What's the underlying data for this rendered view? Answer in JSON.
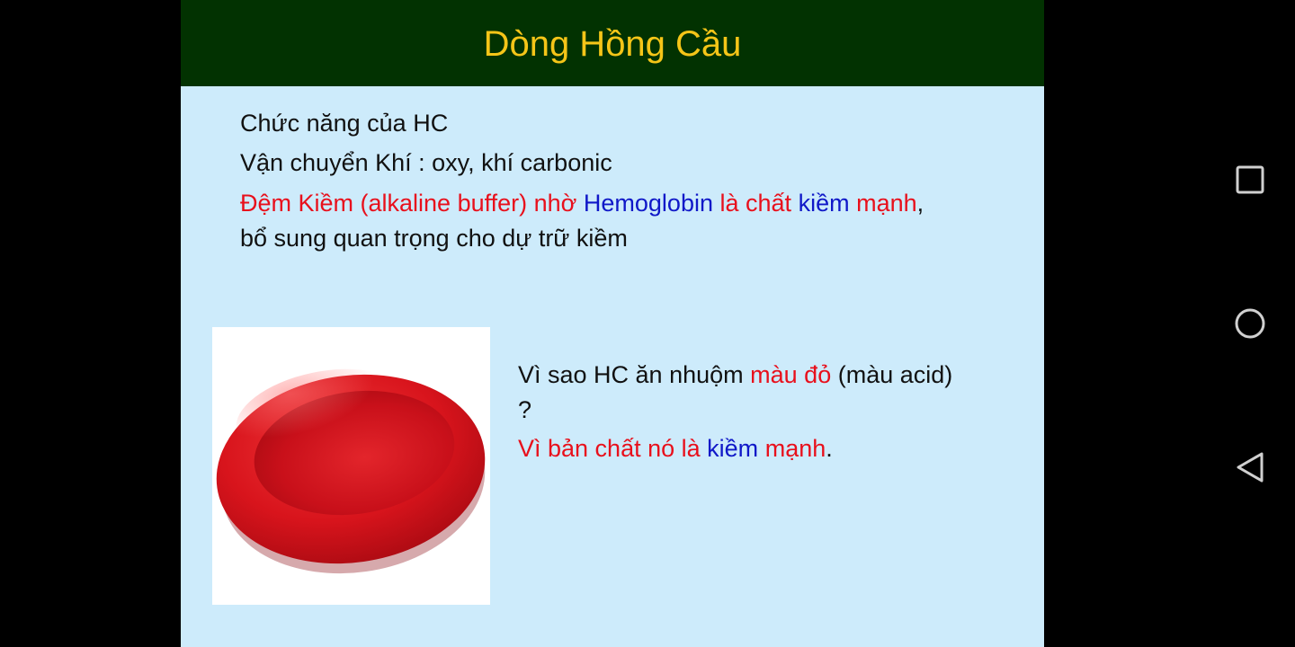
{
  "colors": {
    "slide_background": "#cdebfb",
    "title_bar": "#023201",
    "title_text": "#f5c518",
    "accent_red": "#e8101c",
    "accent_blue": "#1018c8",
    "rbc_red": "#d8141c"
  },
  "slide": {
    "title": "Dòng Hồng Cầu",
    "line1": "Chức năng của HC",
    "line2": "Vận chuyển Khí : oxy, khí carbonic",
    "line3": {
      "part1": "Đệm Kiềm (alkaline buffer) nhờ",
      "part2": "Hemoglobin",
      "part3": "là chất",
      "part4": "kiềm",
      "part5": "mạnh",
      "part6": ","
    },
    "line4": "bổ sung quan trọng cho dự trữ kiềm",
    "question": {
      "part1": "Vì sao HC ăn nhuộm",
      "part2": "màu đỏ",
      "part3": "(màu acid)",
      "part4": "?"
    },
    "answer": {
      "part1": "Vì bản chất nó là",
      "part2": "kiềm",
      "part3": "mạnh",
      "part4": "."
    },
    "image_icon": "red-blood-cell-icon"
  },
  "nav": {
    "recents_icon": "square-icon",
    "home_icon": "circle-icon",
    "back_icon": "triangle-back-icon"
  }
}
